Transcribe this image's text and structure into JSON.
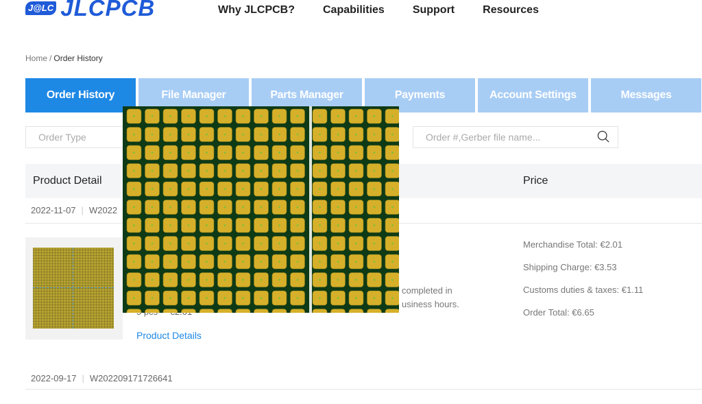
{
  "brand": {
    "badge": "J@LC",
    "name": "JLCPCB",
    "color": "#1f5bd8"
  },
  "nav": [
    {
      "label": "Why JLCPCB?"
    },
    {
      "label": "Capabilities"
    },
    {
      "label": "Support"
    },
    {
      "label": "Resources"
    }
  ],
  "breadcrumb": {
    "home": "Home",
    "separator": "/",
    "current": "Order History"
  },
  "tabs": [
    {
      "label": "Order History",
      "active": true
    },
    {
      "label": "File Manager",
      "active": false
    },
    {
      "label": "Parts Manager",
      "active": false
    },
    {
      "label": "Payments",
      "active": false
    },
    {
      "label": "Account Settings",
      "active": false
    },
    {
      "label": "Messages",
      "active": false
    }
  ],
  "filters": {
    "order_type_placeholder": "Order Type",
    "search_placeholder": "Order #,Gerber file name...",
    "search_icon": "search-icon"
  },
  "table": {
    "headers": {
      "product_detail": "Product Detail",
      "price": "Price"
    }
  },
  "orders": [
    {
      "date": "2022-11-07",
      "number_visible": "W2022",
      "qty_fragment": "5 pcs",
      "price_fragment": "€2.01",
      "product_details_link": "Product Details",
      "status_line1": "completed in",
      "status_line2": "usiness hours.",
      "price": {
        "merchandise": "Merchandise Total: €2.01",
        "shipping": "Shipping Charge: €3.53",
        "customs": "Customs duties & taxes: €1.11",
        "total": "Order Total: €6.65"
      }
    },
    {
      "date": "2022-09-17",
      "number": "W202209171726641"
    }
  ],
  "colors": {
    "tab_active": "#1e88e5",
    "tab_inactive": "#a8cdf5",
    "link": "#1e88e5",
    "pcb_mask": "#0e3a16",
    "pcb_pad": "#d6b02a",
    "pcb_pad_center": "#7fbf3a"
  }
}
